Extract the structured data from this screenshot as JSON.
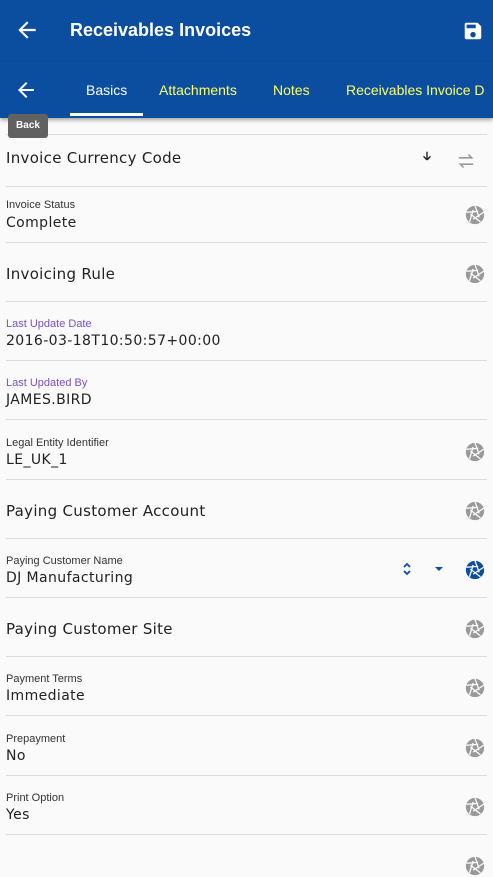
{
  "app_bar": {
    "title": "Receivables Invoices",
    "back_icon": "arrow-left-icon",
    "save_icon": "floppy-disk-icon"
  },
  "tabs": {
    "back_icon": "arrow-left-icon",
    "items": [
      {
        "label": "Basics",
        "active": true
      },
      {
        "label": "Attachments",
        "active": false
      },
      {
        "label": "Notes",
        "active": false
      },
      {
        "label": "Receivables Invoice D",
        "active": false
      }
    ],
    "tooltip": "Back"
  },
  "colors": {
    "primary": "#0b4ea0",
    "tab_text": "#ffff66",
    "label_accent": "#7a50c8",
    "icon_gray": "#999999",
    "icon_active": "#0b4ea0"
  },
  "fields": [
    {
      "label": "Invoice Currency Code",
      "value": null,
      "icons": [
        "arrow-down-icon",
        "swap-horizontal-icon"
      ]
    },
    {
      "label": "Invoice Status",
      "value": "Complete",
      "icons": [
        "aperture-icon"
      ]
    },
    {
      "label": "Invoicing Rule",
      "value": null,
      "icons": [
        "aperture-icon"
      ]
    },
    {
      "label": "Last Update Date",
      "value": "2016-03-18T10:50:57+00:00",
      "icons": []
    },
    {
      "label": "Last Updated By",
      "value": "JAMES.BIRD",
      "icons": []
    },
    {
      "label": "Legal Entity Identifier",
      "value": "LE_UK_1",
      "icons": [
        "aperture-icon"
      ]
    },
    {
      "label": "Paying Customer Account",
      "value": null,
      "icons": [
        "aperture-icon"
      ]
    },
    {
      "label": "Paying Customer Name",
      "value": "DJ Manufacturing",
      "icons": [
        "chevron-up-down-icon",
        "caret-down-icon",
        "aperture-icon"
      ]
    },
    {
      "label": "Paying Customer Site",
      "value": null,
      "icons": [
        "aperture-icon"
      ]
    },
    {
      "label": "Payment Terms",
      "value": "Immediate",
      "icons": [
        "aperture-icon"
      ]
    },
    {
      "label": "Prepayment",
      "value": "No",
      "icons": [
        "aperture-icon"
      ]
    },
    {
      "label": "Print Option",
      "value": "Yes",
      "icons": [
        "aperture-icon"
      ]
    }
  ]
}
